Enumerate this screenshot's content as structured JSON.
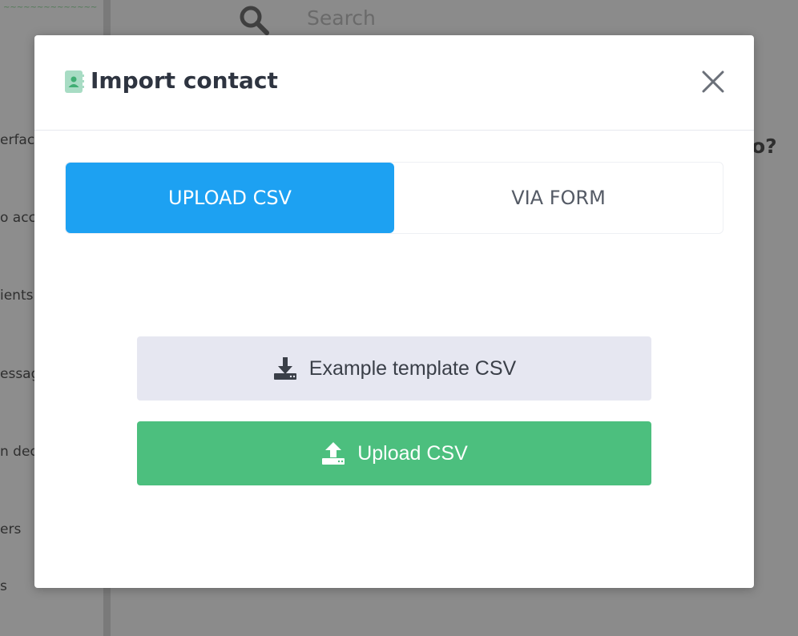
{
  "background": {
    "search_placeholder": "Search",
    "sidebar_items": [
      "erfac",
      "o acc",
      "ients",
      "essag",
      "n dec",
      "ers",
      "s"
    ],
    "heading_fragment": "o?"
  },
  "modal": {
    "title": "Import contact",
    "title_icon": "contact-book-icon",
    "close_icon": "close-icon",
    "tabs": [
      {
        "label": "UPLOAD CSV",
        "active": true
      },
      {
        "label": "VIA FORM",
        "active": false
      }
    ],
    "template_button": {
      "label": "Example template CSV",
      "icon": "download-icon"
    },
    "upload_button": {
      "label": "Upload CSV",
      "icon": "upload-icon"
    }
  },
  "colors": {
    "tab_active": "#1da1f2",
    "upload_button": "#4cbf7e",
    "template_button": "#e6e7f1",
    "title_icon": "#a8dcc4"
  }
}
